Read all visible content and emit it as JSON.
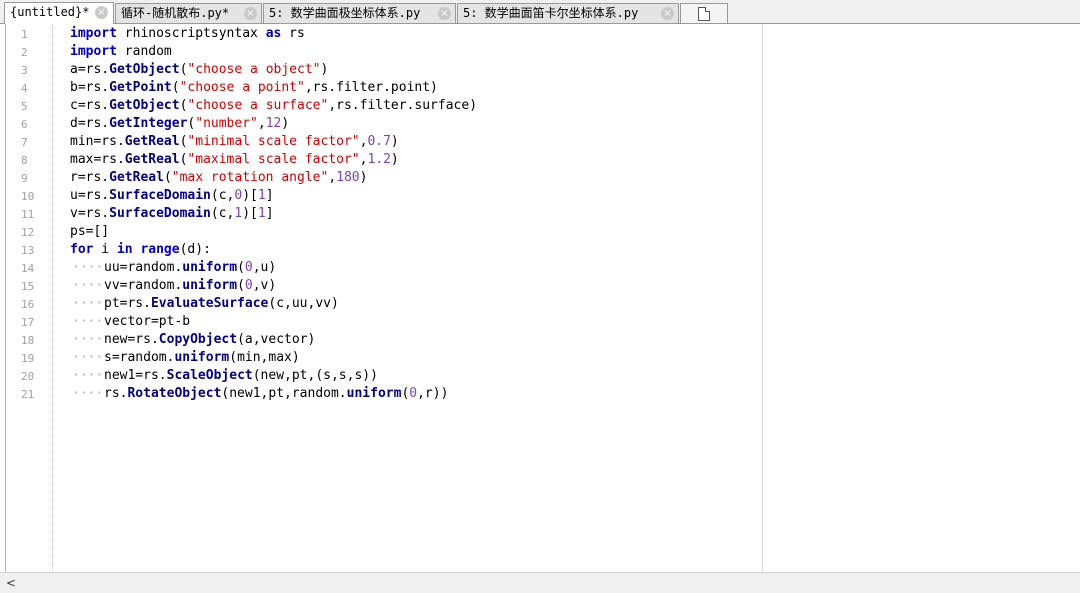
{
  "tabs": [
    {
      "label": "{untitled}*",
      "active": true
    },
    {
      "label": "循环-随机散布.py*",
      "active": false
    },
    {
      "label": "5: 数学曲面极坐标体系.py",
      "active": false
    },
    {
      "label": "5: 数学曲面笛卡尔坐标体系.py",
      "active": false
    }
  ],
  "icons": {
    "close": "close-icon",
    "new_tab": "new-document-icon",
    "scroll_left": "chevron-left-icon"
  },
  "scrollbar": {
    "left_arrow": "<"
  },
  "line_numbers": [
    "1",
    "2",
    "3",
    "4",
    "5",
    "6",
    "7",
    "8",
    "9",
    "10",
    "11",
    "12",
    "13",
    "14",
    "15",
    "16",
    "17",
    "18",
    "19",
    "20",
    "21"
  ],
  "indent_guide": "····",
  "code": {
    "l1": {
      "kw1": "import",
      "t1": " rhinoscriptsyntax ",
      "kw2": "as",
      "t2": " rs"
    },
    "l2": {
      "kw1": "import",
      "t1": " random"
    },
    "l3": {
      "t1": "a=rs.",
      "fn": "GetObject",
      "t2": "(",
      "s1": "\"choose a object\"",
      "t3": ")"
    },
    "l4": {
      "t1": "b=rs.",
      "fn": "GetPoint",
      "t2": "(",
      "s1": "\"choose a point\"",
      "t3": ",rs.filter.point)"
    },
    "l5": {
      "t1": "c=rs.",
      "fn": "GetObject",
      "t2": "(",
      "s1": "\"choose a surface\"",
      "t3": ",rs.filter.surface)"
    },
    "l6": {
      "t1": "d=rs.",
      "fn": "GetInteger",
      "t2": "(",
      "s1": "\"number\"",
      "t3": ",",
      "n1": "12",
      "t4": ")"
    },
    "l7": {
      "t1": "min=rs.",
      "fn": "GetReal",
      "t2": "(",
      "s1": "\"minimal scale factor\"",
      "t3": ",",
      "n1": "0.7",
      "t4": ")"
    },
    "l8": {
      "t1": "max=rs.",
      "fn": "GetReal",
      "t2": "(",
      "s1": "\"maximal scale factor\"",
      "t3": ",",
      "n1": "1.2",
      "t4": ")"
    },
    "l9": {
      "t1": "r=rs.",
      "fn": "GetReal",
      "t2": "(",
      "s1": "\"max rotation angle\"",
      "t3": ",",
      "n1": "180",
      "t4": ")"
    },
    "l10": {
      "t1": "u=rs.",
      "fn": "SurfaceDomain",
      "t2": "(c,",
      "n1": "0",
      "t3": ")[",
      "n2": "1",
      "t4": "]"
    },
    "l11": {
      "t1": "v=rs.",
      "fn": "SurfaceDomain",
      "t2": "(c,",
      "n1": "1",
      "t3": ")[",
      "n2": "1",
      "t4": "]"
    },
    "l12": {
      "t1": "ps=[]"
    },
    "l13": {
      "kw1": "for",
      "t1": " i ",
      "kw2": "in",
      "t2": " ",
      "kw3": "range",
      "t3": "(d):"
    },
    "l14": {
      "t1": "uu=random.",
      "fn": "uniform",
      "t2": "(",
      "n1": "0",
      "t3": ",u)"
    },
    "l15": {
      "t1": "vv=random.",
      "fn": "uniform",
      "t2": "(",
      "n1": "0",
      "t3": ",v)"
    },
    "l16": {
      "t1": "pt=rs.",
      "fn": "EvaluateSurface",
      "t2": "(c,uu,vv)"
    },
    "l17": {
      "t1": "vector=pt-b"
    },
    "l18": {
      "t1": "new=rs.",
      "fn": "CopyObject",
      "t2": "(a,vector)"
    },
    "l19": {
      "t1": "s=random.",
      "fn": "uniform",
      "t2": "(min,max)"
    },
    "l20": {
      "t1": "new1=rs.",
      "fn": "ScaleObject",
      "t2": "(new,pt,(s,s,s))"
    },
    "l21": {
      "t1": "rs.",
      "fn": "RotateObject",
      "t2": "(new1,pt,random.",
      "fn2": "uniform",
      "t3": "(",
      "n1": "0",
      "t4": ",r))"
    }
  }
}
